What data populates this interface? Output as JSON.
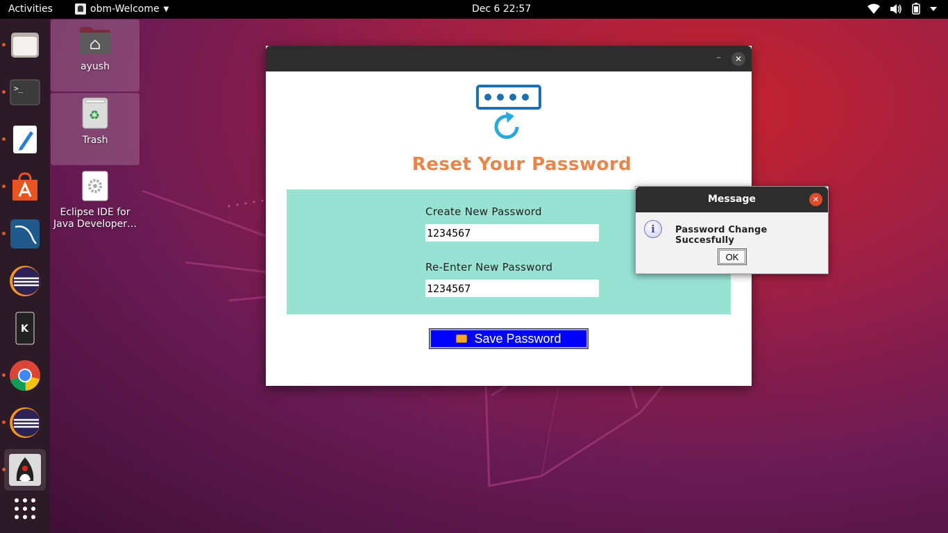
{
  "topbar": {
    "activities": "Activities",
    "app_name": "obm-Welcome",
    "clock": "Dec 6  22:57"
  },
  "desktop": {
    "icons": [
      {
        "label": "ayush",
        "icon": "home-folder-icon"
      },
      {
        "label": "Trash",
        "icon": "trash-icon"
      },
      {
        "label": "Eclipse IDE for Java Developer…",
        "icon": "gear-icon"
      }
    ]
  },
  "dock": {
    "items": [
      "files",
      "terminal",
      "text-editor",
      "software-center",
      "mysql-workbench",
      "eclipse",
      "kde-connect",
      "chrome",
      "eclipse-2",
      "java-app"
    ]
  },
  "window": {
    "title": "Reset Your Password",
    "field1_label": "Create New Password",
    "field1_value": "1234567",
    "field2_label": "Re-Enter New Password",
    "field2_value": "1234567",
    "save_button": "Save Password"
  },
  "dialog": {
    "title": "Message",
    "message": "Password Change Succesfully",
    "ok_button": "OK"
  },
  "colors": {
    "accent_orange": "#e8854a",
    "panel_teal": "#98e2d4",
    "button_blue": "#0000ff",
    "ubuntu_orange": "#e95420"
  }
}
